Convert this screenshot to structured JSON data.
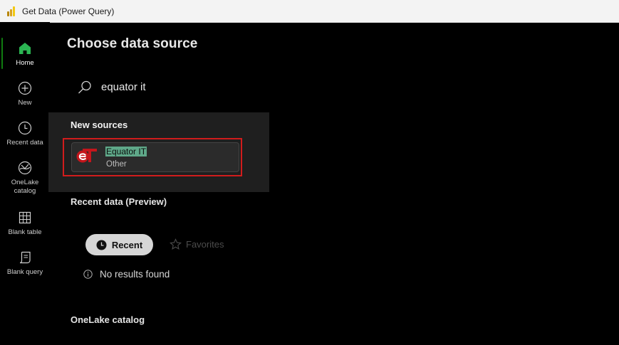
{
  "window": {
    "title": "Get Data (Power Query)"
  },
  "sidebar": {
    "items": [
      {
        "label": "Home",
        "icon": "home-icon",
        "active": true
      },
      {
        "label": "New",
        "icon": "add-circle-icon"
      },
      {
        "label": "Recent data",
        "icon": "clock-icon"
      },
      {
        "label": "OneLake catalog",
        "label_line1": "OneLake",
        "label_line2": "catalog",
        "icon": "onelake-icon"
      },
      {
        "label": "Blank table",
        "icon": "table-grid-icon"
      },
      {
        "label": "Blank query",
        "icon": "script-icon"
      }
    ]
  },
  "main": {
    "title": "Choose data source",
    "search": {
      "value": "equator it",
      "icon": "search-icon"
    },
    "dropdown": {
      "heading": "New sources",
      "results": [
        {
          "name": "Equator IT",
          "category": "Other",
          "icon": "equator-it-logo"
        }
      ]
    },
    "recent": {
      "heading": "Recent data (Preview)",
      "tabs": [
        {
          "label": "Recent",
          "icon": "clock-filled-icon",
          "selected": true
        },
        {
          "label": "Favorites",
          "icon": "star-icon",
          "selected": false
        }
      ],
      "empty_message": "No results found"
    },
    "onelake": {
      "heading": "OneLake catalog"
    }
  },
  "colors": {
    "accent_active": "#107c10",
    "highlight_border": "#d11c1c",
    "search_match": "#5fa889",
    "dropdown_bg": "#1f1f1f"
  }
}
